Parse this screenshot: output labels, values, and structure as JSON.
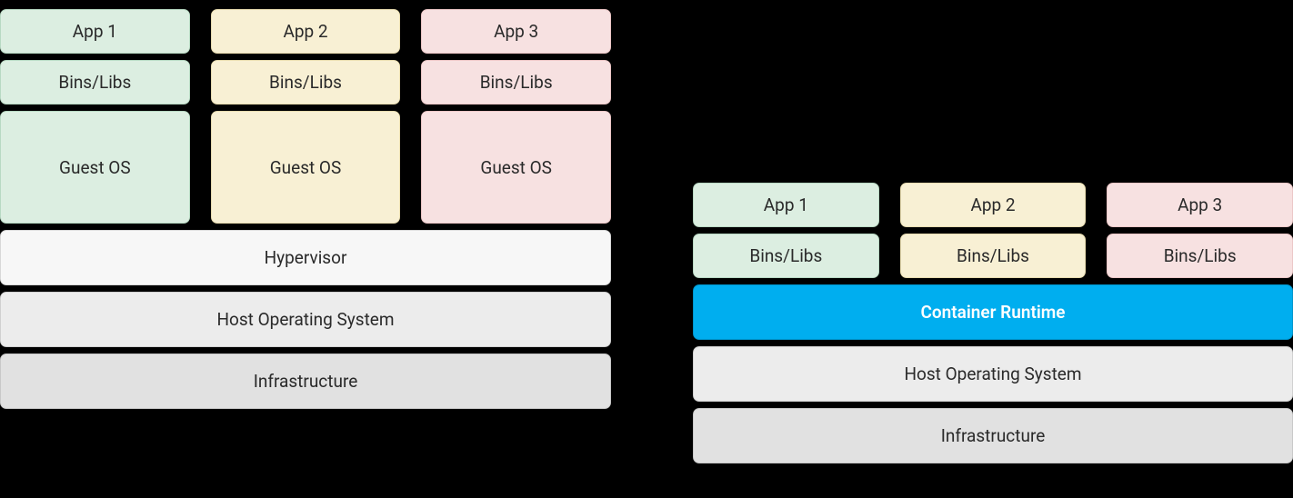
{
  "vm": {
    "apps": [
      "App 1",
      "App 2",
      "App 3"
    ],
    "bins": [
      "Bins/Libs",
      "Bins/Libs",
      "Bins/Libs"
    ],
    "guest": [
      "Guest OS",
      "Guest OS",
      "Guest OS"
    ],
    "hypervisor": "Hypervisor",
    "host": "Host Operating System",
    "infra": "Infrastructure"
  },
  "container": {
    "apps": [
      "App 1",
      "App 2",
      "App 3"
    ],
    "bins": [
      "Bins/Libs",
      "Bins/Libs",
      "Bins/Libs"
    ],
    "runtime": "Container Runtime",
    "host": "Host Operating System",
    "infra": "Infrastructure"
  }
}
